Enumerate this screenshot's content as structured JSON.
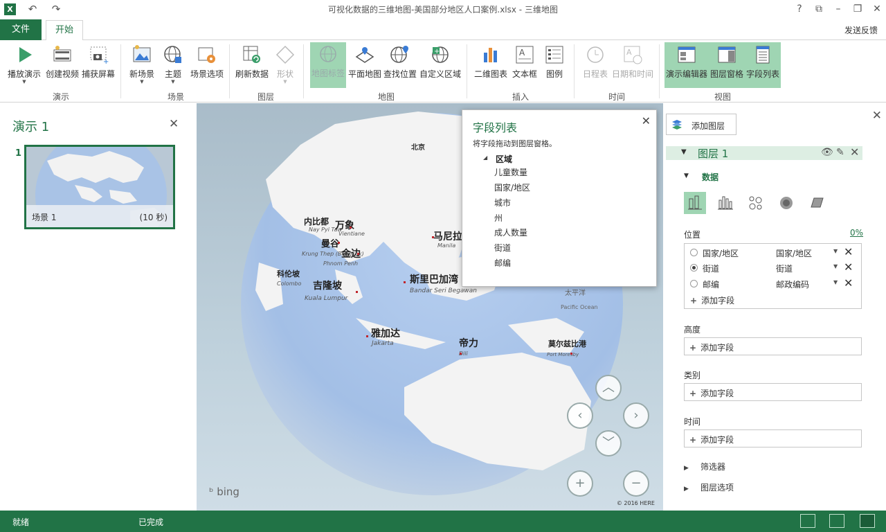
{
  "window": {
    "title": "可视化数据的三维地图-美国部分地区人口案例.xlsx - 三维地图",
    "logo": "X"
  },
  "tabs": {
    "file": "文件",
    "home": "开始",
    "feedback": "发送反馈"
  },
  "ribbon": {
    "groups": {
      "tour": "演示",
      "scene": "场景",
      "layer": "图层",
      "map": "地图",
      "insert": "插入",
      "time": "时间",
      "view": "视图"
    },
    "buttons": {
      "play_tour": "播放演示",
      "create_video": "创建视频",
      "capture_screen": "捕获屏幕",
      "new_scene": "新场景",
      "theme": "主题",
      "scene_options": "场景选项",
      "refresh_data": "刷新数据",
      "shapes": "形状",
      "map_labels": "地图标签",
      "flat_map": "平面地图",
      "find_location": "查找位置",
      "custom_regions": "自定义区域",
      "chart_2d": "二维图表",
      "text_box": "文本框",
      "legend": "图例",
      "timeline": "日程表",
      "date_time": "日期和时间",
      "tour_editor": "演示编辑器",
      "layer_pane": "图层窗格",
      "field_list": "字段列表"
    }
  },
  "left_panel": {
    "title": "演示 1",
    "scene_index": "1",
    "scene_name": "场景 1",
    "scene_duration": "(10 秒)"
  },
  "map": {
    "attribution": "bing",
    "copyright": "© 2016 HERE",
    "labels": [
      {
        "cn": "北京",
        "en": ""
      },
      {
        "cn": "内比都",
        "en": "Nay Pyi Taw"
      },
      {
        "cn": "万象",
        "en": "Vientiane"
      },
      {
        "cn": "曼谷",
        "en": "Krung Thep (Bangkok)"
      },
      {
        "cn": "金边",
        "en": "Phnom Penh"
      },
      {
        "cn": "马尼拉",
        "en": "Manila"
      },
      {
        "cn": "科伦坡",
        "en": "Colombo"
      },
      {
        "cn": "吉隆坡",
        "en": "Kuala Lumpur"
      },
      {
        "cn": "斯里巴加湾",
        "en": "Bandar Seri Begawan"
      },
      {
        "cn": "雅加达",
        "en": "Jakarta"
      },
      {
        "cn": "帝力",
        "en": "Dili"
      },
      {
        "cn": "莫尔兹比港",
        "en": "Port Moresby"
      },
      {
        "cn": "太平洋",
        "en": "Pacific Ocean"
      }
    ]
  },
  "field_list": {
    "title": "字段列表",
    "hint": "将字段拖动到图层窗格。",
    "group": "区域",
    "items": [
      "儿童数量",
      "国家/地区",
      "城市",
      "州",
      "成人数量",
      "街道",
      "邮编"
    ]
  },
  "right_panel": {
    "add_layer": "添加图层",
    "layer_name": "图层 1",
    "data_section": "数据",
    "location_label": "位置",
    "location_percent": "0%",
    "location_rows": [
      {
        "field": "国家/地区",
        "geo": "国家/地区",
        "selected": false
      },
      {
        "field": "街道",
        "geo": "街道",
        "selected": true
      },
      {
        "field": "邮编",
        "geo": "邮政编码",
        "selected": false
      }
    ],
    "add_field": "添加字段",
    "height_label": "高度",
    "category_label": "类别",
    "time_label": "时间",
    "filters": "筛选器",
    "layer_options": "图层选项"
  },
  "status": {
    "ready": "就绪",
    "done": "已完成"
  },
  "colors": {
    "accent": "#217346",
    "active": "#9fd5b3"
  }
}
